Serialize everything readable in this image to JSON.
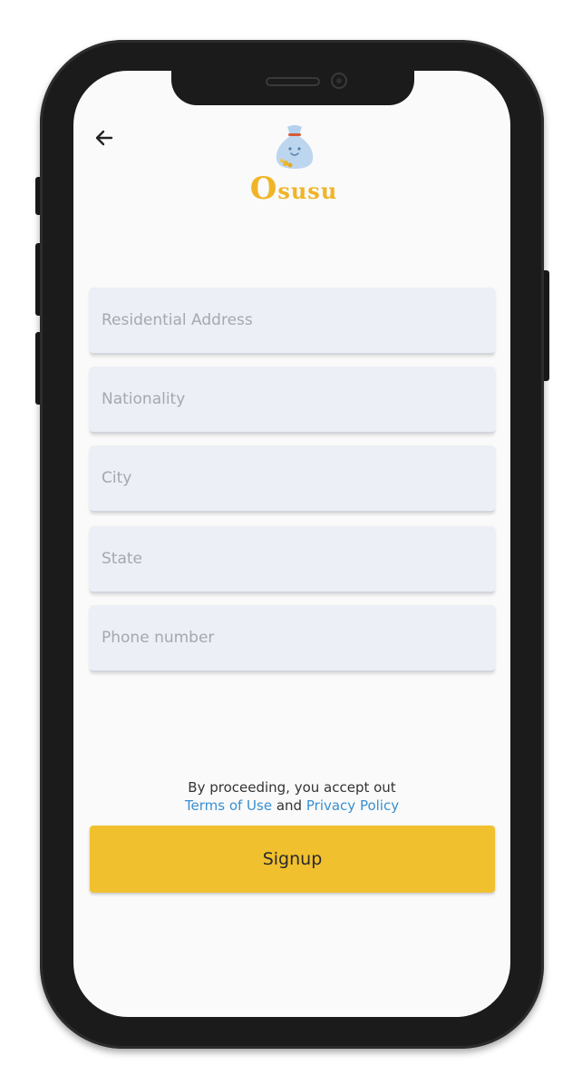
{
  "app": {
    "logo_text_first": "O",
    "logo_text_rest": "susu",
    "brand_color": "#f0b428"
  },
  "header": {
    "back_icon": "arrow-left-icon"
  },
  "form": {
    "residential_address": {
      "placeholder": "Residential Address",
      "value": ""
    },
    "nationality": {
      "placeholder": "Nationality",
      "value": ""
    },
    "city": {
      "placeholder": "City",
      "value": ""
    },
    "state": {
      "placeholder": "State",
      "value": ""
    },
    "phone_number": {
      "placeholder": "Phone number",
      "value": ""
    }
  },
  "terms": {
    "prefix": "By proceeding, you accept out",
    "terms_link": "Terms of Use",
    "conjunction": "and",
    "privacy_link": "Privacy Policy",
    "link_color": "#3a8fd0"
  },
  "actions": {
    "signup_label": "Signup",
    "signup_color": "#f0c02e"
  }
}
